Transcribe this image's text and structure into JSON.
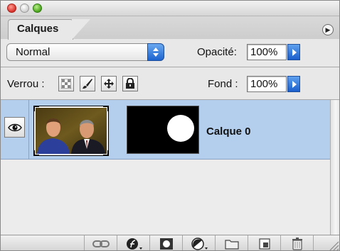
{
  "panel": {
    "tab_label": "Calques",
    "blend_mode": "Normal",
    "opacity_label": "Opacité:",
    "opacity_value": "100%",
    "lock_label": "Verrou :",
    "fill_label": "Fond :",
    "fill_value": "100%"
  },
  "layers": [
    {
      "name": "Calque 0",
      "visible": true,
      "selected": true
    }
  ],
  "icons": {
    "lock_transparency": "checkerboard-icon",
    "lock_pixels": "brush-icon",
    "lock_position": "move-icon",
    "lock_all": "padlock-icon",
    "toolbar": [
      "link-icon",
      "layer-style-icon",
      "layer-mask-icon",
      "adjustment-layer-icon",
      "new-group-icon",
      "new-layer-icon",
      "trash-icon"
    ]
  },
  "colors": {
    "selection": "#b4cfee",
    "accent_blue": "#1c63cf"
  }
}
